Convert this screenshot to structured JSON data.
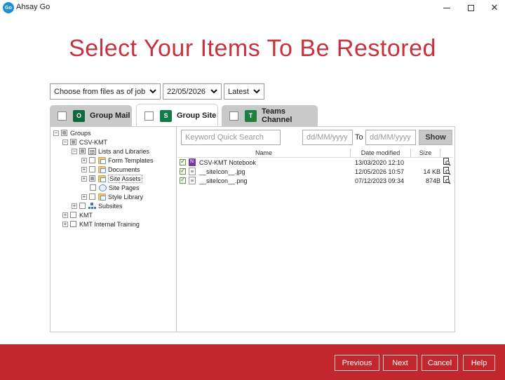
{
  "window": {
    "title": "Ahsay Go",
    "logo_text": "Go"
  },
  "heading": "Select Your Items To Be Restored",
  "filters": {
    "job_mode": "Choose from files as of job",
    "date": "22/05/2026",
    "version": "Latest"
  },
  "tabs": [
    {
      "label": "Group Mail",
      "icon": "outlook-icon",
      "active": false
    },
    {
      "label": "Group Site",
      "icon": "sharepoint-icon",
      "active": true
    },
    {
      "label": "Teams Channel",
      "icon": "teams-icon",
      "active": false
    }
  ],
  "tree": {
    "groups": "Groups",
    "csv_kmt": "CSV-KMT",
    "lists_libraries": "Lists and Libraries",
    "form_templates": "Form Templates",
    "documents": "Documents",
    "site_assets": "Site Assets",
    "site_pages": "Site Pages",
    "style_library": "Style Library",
    "subsites": "Subsites",
    "kmt": "KMT",
    "kmt_internal": "KMT Internal Training"
  },
  "search": {
    "keyword_placeholder": "Keyword Quick Search",
    "date_from_placeholder": "dd/MM/yyyy",
    "to_label": "To",
    "date_to_placeholder": "dd/MM/yyyy",
    "show_label": "Show"
  },
  "table": {
    "columns": {
      "name": "Name",
      "date": "Date modified",
      "size": "Size"
    },
    "rows": [
      {
        "name": "CSV-KMT Notebook",
        "date": "13/03/2020 12:10",
        "size": "",
        "type": "onenote"
      },
      {
        "name": "__siteIcon__.jpg",
        "date": "12/05/2026 10:57",
        "size": "14 KB",
        "type": "image"
      },
      {
        "name": "__siteIcon__.png",
        "date": "07/12/2023 09:34",
        "size": "874B",
        "type": "image"
      }
    ]
  },
  "footer": {
    "previous": "Previous",
    "next": "Next",
    "cancel": "Cancel",
    "help": "Help"
  },
  "colors": {
    "accent": "#c1272d",
    "heading": "#c8313f"
  }
}
